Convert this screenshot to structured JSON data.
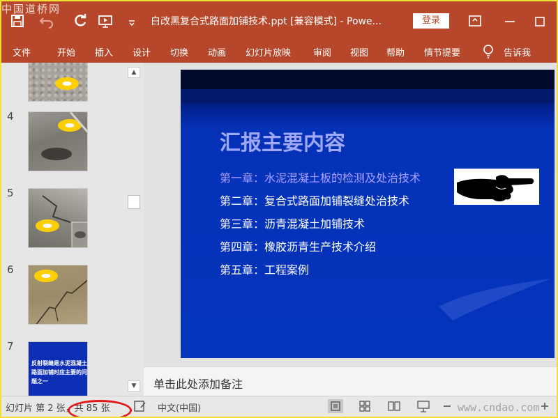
{
  "watermark": {
    "top": "中国道桥网",
    "bottom": "www.cndao.com"
  },
  "titlebar": {
    "title": "白改黑复合式路面加铺技术.ppt [兼容模式]  -  Powe...",
    "login_label": "登录",
    "icons": [
      "save-icon",
      "undo-icon",
      "redo-icon",
      "present-from-start-icon",
      "customize-qat-icon",
      "ribbon-display-icon"
    ]
  },
  "ribbon": {
    "tabs": [
      "文件",
      "开始",
      "插入",
      "设计",
      "切换",
      "动画",
      "幻灯片放映",
      "审阅",
      "视图",
      "帮助",
      "情节提要"
    ],
    "tell_me": "告诉我",
    "colors": {
      "accent": "#b7472a"
    }
  },
  "thumbnails": [
    {
      "num": "",
      "kind": "road-gravel"
    },
    {
      "num": "4",
      "kind": "road-pothole"
    },
    {
      "num": "5",
      "kind": "road-cracked-inset"
    },
    {
      "num": "6",
      "kind": "road-dirt-crack"
    },
    {
      "num": "7",
      "kind": "blue-text",
      "text": "反射裂缝是水泥混凝土路面加铺时应主要的问题之一"
    }
  ],
  "slide": {
    "title": "汇报主要内容",
    "chapters": [
      "第一章：水泥混凝土板的检测及处治技术",
      "第二章：复合式路面加铺裂缝处治技术",
      "第三章：沥青混凝土加铺技术",
      "第四章：橡胶沥青生产技术介绍",
      "第五章：工程案例"
    ],
    "colors": {
      "title": "#9fa8f7",
      "first_chapter": "#a9a0ff",
      "text": "#ffffff",
      "background": "#0534bd"
    }
  },
  "notes": {
    "placeholder": "单击此处添加备注"
  },
  "statusbar": {
    "slide_info": "幻灯片 第 2 张，共 85 张",
    "language": "中文(中国)"
  }
}
